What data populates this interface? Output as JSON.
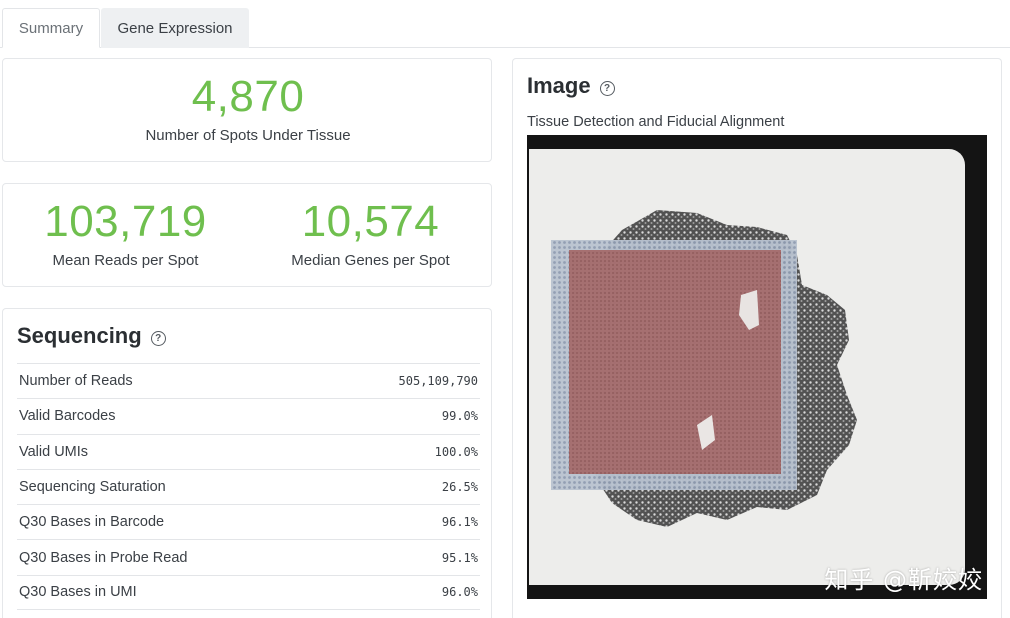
{
  "tabs": [
    {
      "label": "Summary"
    },
    {
      "label": "Gene Expression"
    }
  ],
  "summary": {
    "spots_under_tissue": {
      "value": "4,870",
      "label": "Number of Spots Under Tissue"
    },
    "mean_reads": {
      "value": "103,719",
      "label": "Mean Reads per Spot"
    },
    "median_genes": {
      "value": "10,574",
      "label": "Median Genes per Spot"
    }
  },
  "sequencing": {
    "title": "Sequencing",
    "rows": [
      {
        "label": "Number of Reads",
        "value": "505,109,790"
      },
      {
        "label": "Valid Barcodes",
        "value": "99.0%"
      },
      {
        "label": "Valid UMIs",
        "value": "100.0%"
      },
      {
        "label": "Sequencing Saturation",
        "value": "26.5%"
      },
      {
        "label": "Q30 Bases in Barcode",
        "value": "96.1%"
      },
      {
        "label": "Q30 Bases in Probe Read",
        "value": "95.1%"
      },
      {
        "label": "Q30 Bases in UMI",
        "value": "96.0%"
      }
    ]
  },
  "image": {
    "title": "Image",
    "subtitle": "Tissue Detection and Fiducial Alignment",
    "watermark": "知乎 @靳姣姣"
  },
  "colors": {
    "accent_green": "#6fbf4e",
    "tissue_overlay": "#a86a6a",
    "fiducial_grid": "#b8c4d4"
  },
  "icons": {
    "help": "question-circle-icon"
  }
}
